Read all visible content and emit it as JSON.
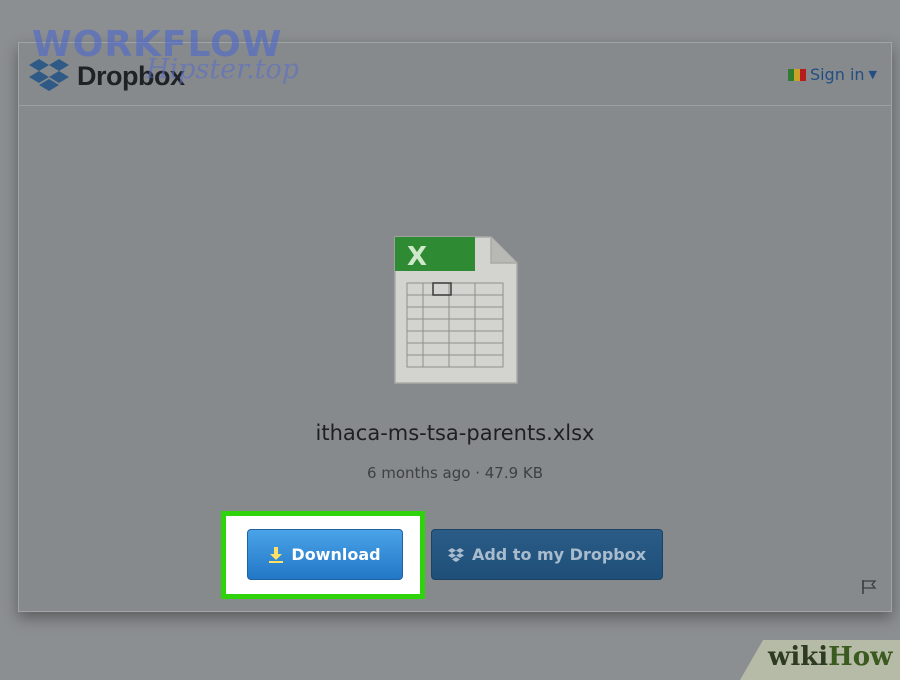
{
  "header": {
    "brand": "Dropbox",
    "signin_label": "Sign in"
  },
  "file": {
    "name": "ithaca-ms-tsa-parents.xlsx",
    "meta": "6 months ago · 47.9 KB"
  },
  "actions": {
    "download_label": "Download",
    "add_label": "Add to my Dropbox"
  },
  "watermark": {
    "line1": "WORKFLOW",
    "line2": "Hipster.top"
  },
  "footer_brand": {
    "wiki": "wiki",
    "how": "How"
  },
  "colors": {
    "download": "#2b86d6",
    "add": "#245683",
    "highlight": "#2ed30c",
    "excel_green": "#2e8b34"
  },
  "icons": [
    "dropbox-logo-icon",
    "excel-file-icon",
    "download-arrow-icon",
    "dropbox-small-icon",
    "flag-icon",
    "report-flag-icon"
  ]
}
